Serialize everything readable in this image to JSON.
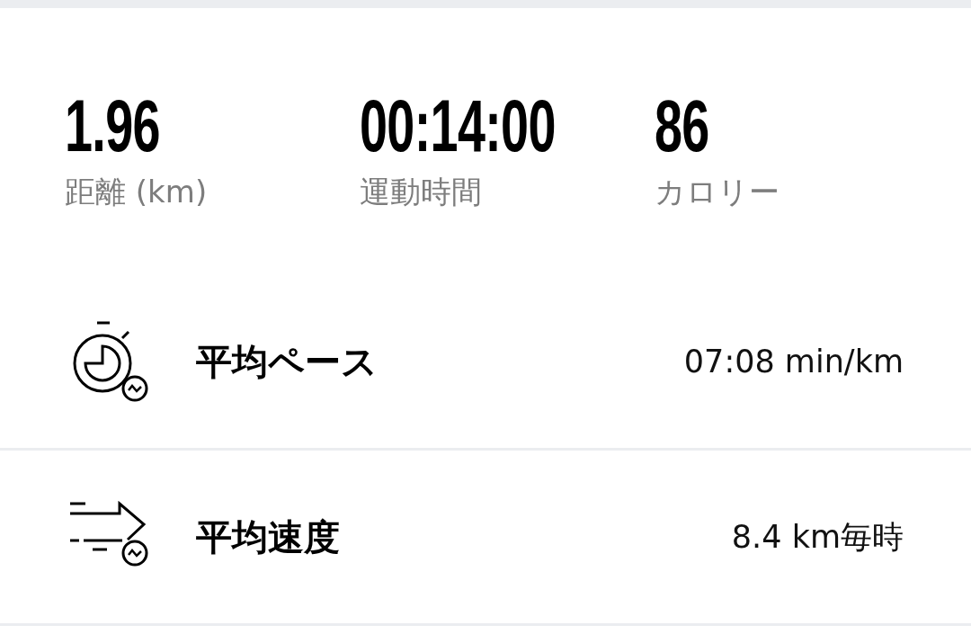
{
  "stats": [
    {
      "value": "1.96",
      "label": "距離 (km)"
    },
    {
      "value": "00:14:00",
      "label": "運動時間"
    },
    {
      "value": "86",
      "label": "カロリー"
    }
  ],
  "metrics": [
    {
      "kind": "pace",
      "label": "平均ペース",
      "value": "07:08 min/km"
    },
    {
      "kind": "speed",
      "label": "平均速度",
      "value": "8.4 km毎時"
    }
  ]
}
